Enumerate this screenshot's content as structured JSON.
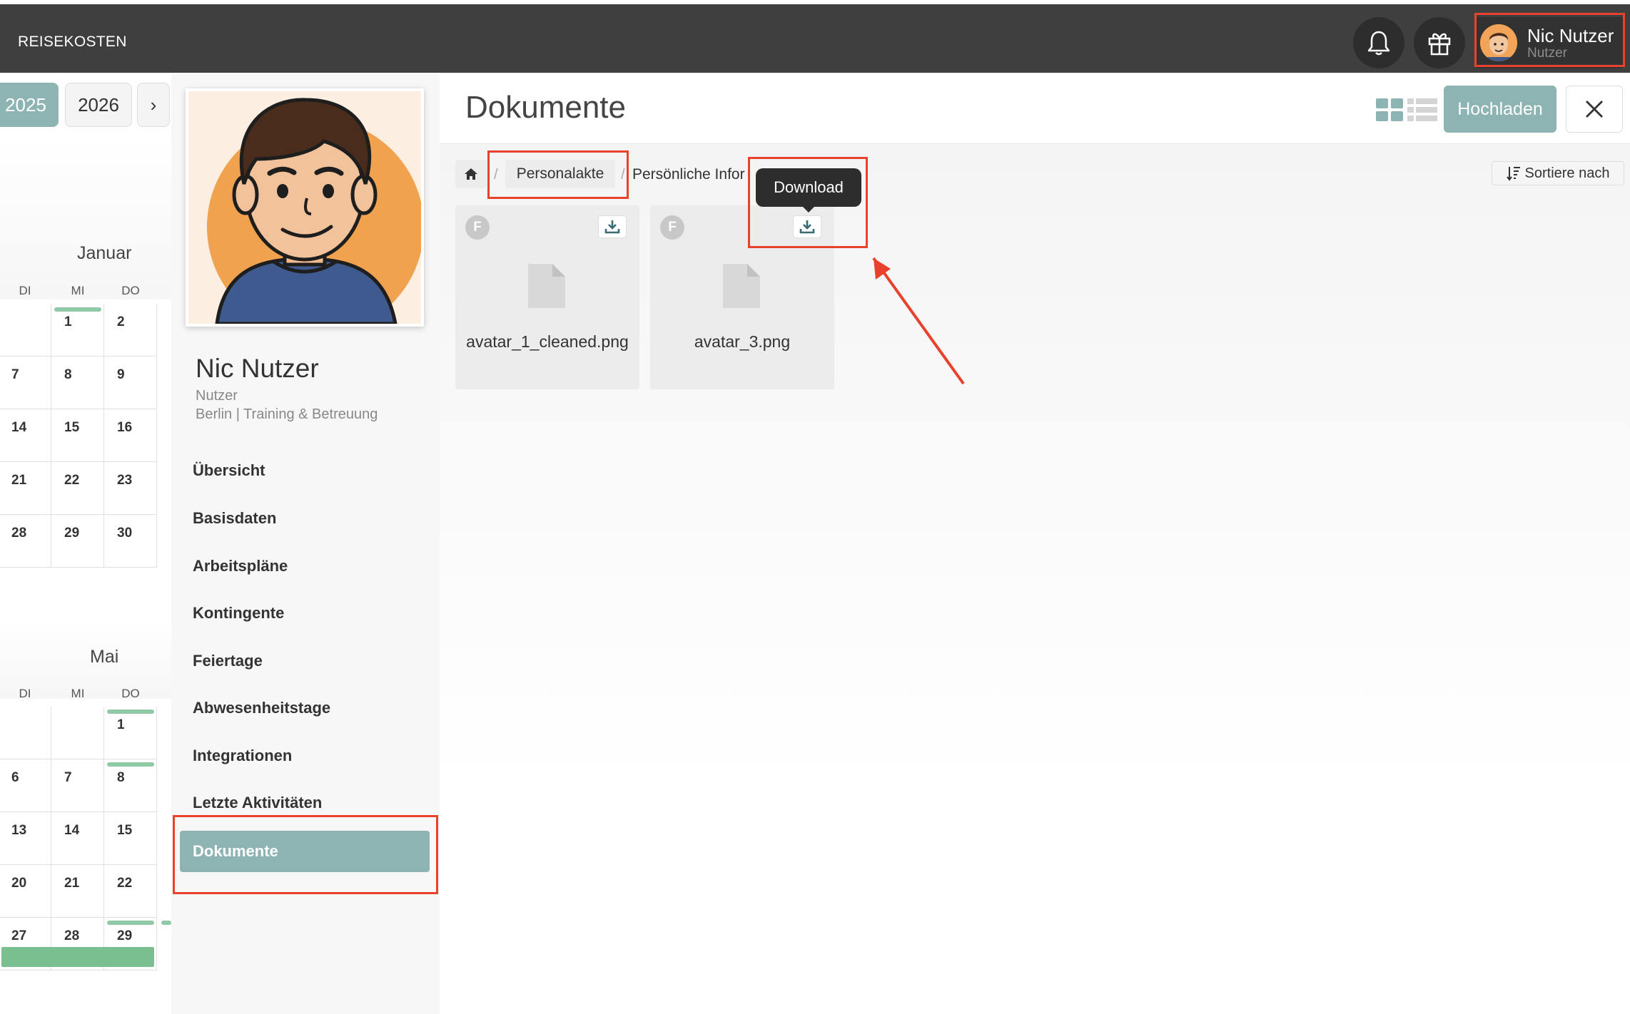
{
  "app": {
    "title": "REISEKOSTEN"
  },
  "header": {
    "user_name": "Nic Nutzer",
    "user_role": "Nutzer"
  },
  "calendar": {
    "years": [
      "2025",
      "2026"
    ],
    "next_label": "›",
    "months": [
      {
        "name": "Januar",
        "weekdays": [
          "DI",
          "MI",
          "DO"
        ],
        "rows": [
          [
            "",
            "1",
            "2"
          ],
          [
            "7",
            "8",
            "9"
          ],
          [
            "14",
            "15",
            "16"
          ],
          [
            "21",
            "22",
            "23"
          ],
          [
            "28",
            "29",
            "30"
          ]
        ]
      },
      {
        "name": "Mai",
        "weekdays": [
          "DI",
          "MI",
          "DO"
        ],
        "rows": [
          [
            "",
            "",
            "1"
          ],
          [
            "6",
            "7",
            "8"
          ],
          [
            "13",
            "14",
            "15"
          ],
          [
            "20",
            "21",
            "22"
          ],
          [
            "27",
            "28",
            "29"
          ]
        ]
      }
    ]
  },
  "profile": {
    "name": "Nic Nutzer",
    "role": "Nutzer",
    "location": "Berlin | Training & Betreuung"
  },
  "nav": {
    "items": [
      "Übersicht",
      "Basisdaten",
      "Arbeitspläne",
      "Kontingente",
      "Feiertage",
      "Abwesenheitstage",
      "Integrationen",
      "Letzte Aktivitäten"
    ],
    "active": "Dokumente"
  },
  "main": {
    "title": "Dokumente",
    "upload_label": "Hochladen",
    "sort_label": "Sortiere nach",
    "breadcrumb": [
      "Personalakte",
      "Persönliche Infor"
    ],
    "tooltip": "Download",
    "files": [
      {
        "badge": "F",
        "name": "avatar_1_cleaned.png"
      },
      {
        "badge": "F",
        "name": "avatar_3.png"
      }
    ]
  },
  "colors": {
    "accent": "#8db3b3",
    "topbar": "#3f3f3f",
    "highlight": "#e8412c",
    "event_bar": "#8fc9a6"
  }
}
